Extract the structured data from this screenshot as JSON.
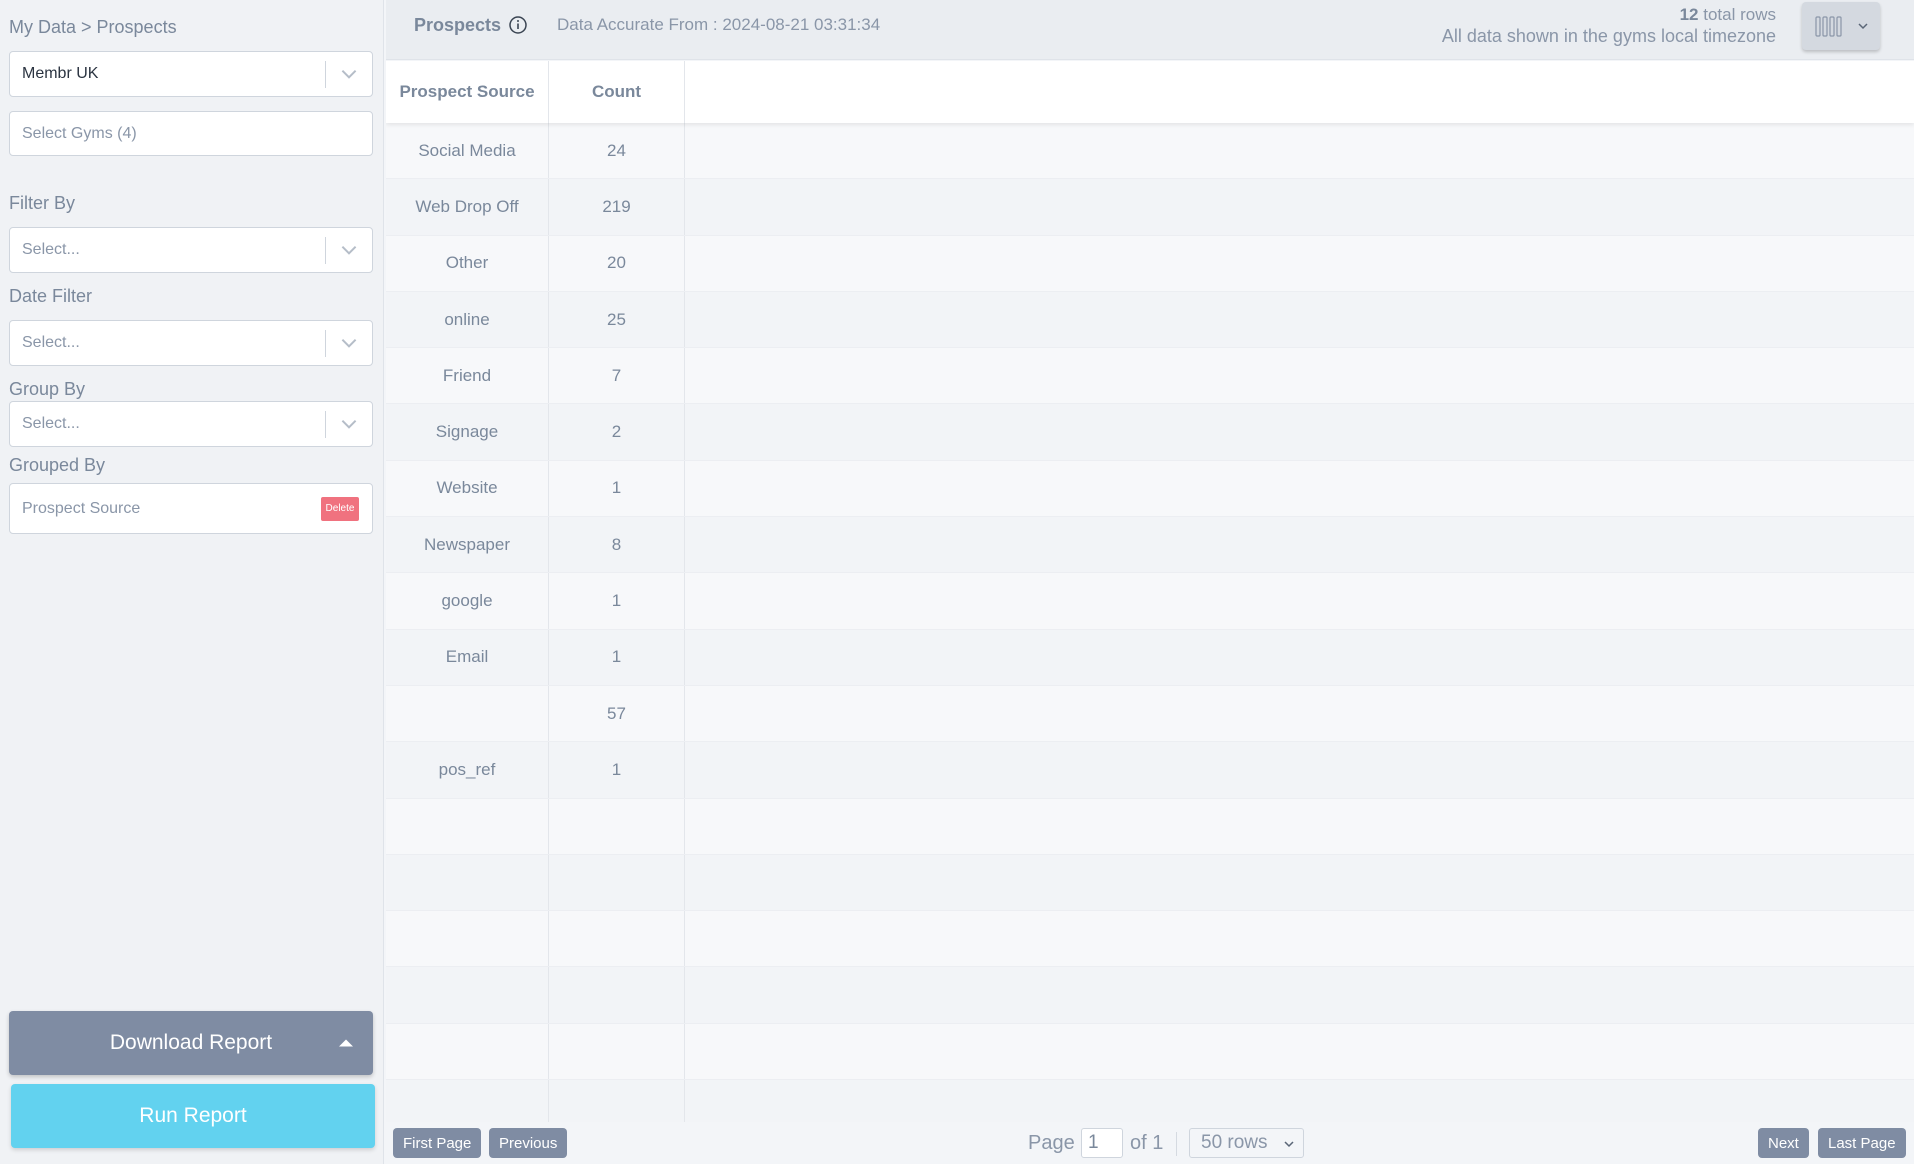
{
  "sidebar": {
    "breadcrumb": "My Data > Prospects",
    "organization": "Membr UK",
    "gyms_placeholder": "Select Gyms (4)",
    "filter_by": {
      "label": "Filter By",
      "value": "Select..."
    },
    "date_filter": {
      "label": "Date Filter",
      "value": "Select..."
    },
    "group_by": {
      "label": "Group By",
      "value": "Select..."
    },
    "grouped_by": {
      "label": "Grouped By",
      "value": "Prospect Source",
      "delete_label": "Delete"
    },
    "download_label": "Download Report",
    "run_label": "Run Report"
  },
  "header": {
    "title": "Prospects",
    "accurate_from": "Data Accurate From : 2024-08-21 03:31:34",
    "total_rows_count": "12",
    "total_rows_suffix": " total rows",
    "timezone_note": "All data shown in the gyms local timezone"
  },
  "table": {
    "columns": [
      "Prospect Source",
      "Count"
    ],
    "rows": [
      [
        "Social Media",
        "24"
      ],
      [
        "Web Drop Off",
        "219"
      ],
      [
        "Other",
        "20"
      ],
      [
        "online",
        "25"
      ],
      [
        "Friend",
        "7"
      ],
      [
        "Signage",
        "2"
      ],
      [
        "Website",
        "1"
      ],
      [
        "Newspaper",
        "8"
      ],
      [
        "google",
        "1"
      ],
      [
        "Email",
        "1"
      ],
      [
        "",
        "57"
      ],
      [
        "pos_ref",
        "1"
      ]
    ],
    "empty_rows": 6
  },
  "pager": {
    "first_label": "First Page",
    "previous_label": "Previous",
    "page_label": "Page",
    "page_value": "1",
    "of_label": "of 1",
    "rows_option": "50 rows",
    "next_label": "Next",
    "last_label": "Last Page"
  },
  "colors": {
    "accent_run": "#62d2ef",
    "button_gray": "#7f8ca3",
    "delete_red": "#f0727f"
  }
}
